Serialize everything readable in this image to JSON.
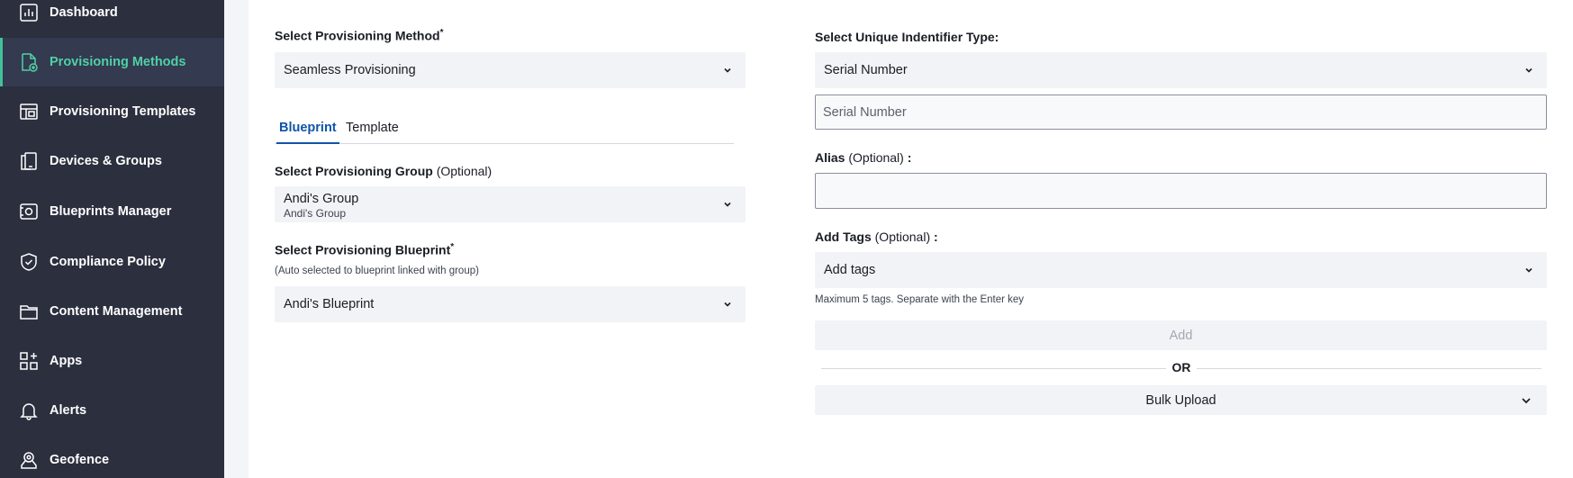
{
  "sidebar": {
    "accent_color": "#42c29a",
    "items": [
      {
        "label": "Dashboard",
        "icon": "dashboard-icon"
      },
      {
        "label": "Provisioning Methods",
        "icon": "provisioning-methods-icon",
        "active": true
      },
      {
        "label": "Provisioning Templates",
        "icon": "templates-icon"
      },
      {
        "label": "Devices & Groups",
        "icon": "devices-icon"
      },
      {
        "label": "Blueprints Manager",
        "icon": "blueprints-icon"
      },
      {
        "label": "Compliance Policy",
        "icon": "shield-icon"
      },
      {
        "label": "Content Management",
        "icon": "folder-icon"
      },
      {
        "label": "Apps",
        "icon": "apps-icon"
      },
      {
        "label": "Alerts",
        "icon": "bell-icon"
      },
      {
        "label": "Geofence",
        "icon": "location-icon"
      }
    ]
  },
  "left": {
    "method_label": "Select Provisioning Method",
    "method_required": "*",
    "method_value": "Seamless Provisioning",
    "tabs": [
      "Blueprint",
      "Template"
    ],
    "group_label": "Select Provisioning Group",
    "group_optional": "(Optional)",
    "group_value": "Andi's Group",
    "group_value_sub": "Andi's Group",
    "blueprint_label": "Select Provisioning Blueprint",
    "blueprint_required": "*",
    "blueprint_hint": "(Auto selected to blueprint linked with group)",
    "blueprint_value": "Andi's Blueprint"
  },
  "right": {
    "identifier_label": "Select Unique Indentifier Type:",
    "identifier_value": "Serial Number",
    "serial_placeholder": "Serial Number",
    "alias_label": "Alias",
    "alias_optional": "(Optional)",
    "alias_colon": ":",
    "alias_value": "",
    "tags_label": "Add Tags",
    "tags_optional": "(Optional)",
    "tags_colon": ":",
    "tags_placeholder": "Add tags",
    "tags_hint": "Maximum 5 tags. Separate with the Enter key",
    "add_button": "Add",
    "or_text": "OR",
    "bulk_upload": "Bulk Upload"
  }
}
